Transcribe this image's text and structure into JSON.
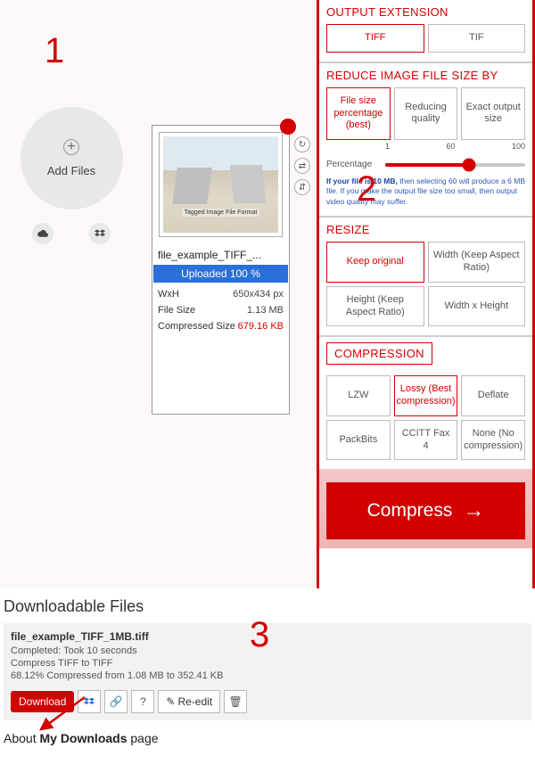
{
  "annotations": {
    "step1": "1",
    "step2": "2",
    "step3": "3"
  },
  "addFiles": {
    "label": "Add Files"
  },
  "fileCard": {
    "thumbCaption": "Tagged Image File Format",
    "name": "file_example_TIFF_...",
    "uploadStatus": "Uploaded 100 %",
    "meta": {
      "wxh_label": "WxH",
      "wxh_value": "650x434 px",
      "size_label": "File Size",
      "size_value": "1.13 MB",
      "comp_label": "Compressed Size",
      "comp_value": "679.16 KB"
    }
  },
  "panel": {
    "outputExt": {
      "title": "OUTPUT EXTENSION",
      "options": [
        "TIFF",
        "TIF"
      ],
      "selected": "TIFF"
    },
    "reduce": {
      "title": "REDUCE IMAGE FILE SIZE BY",
      "options": [
        "File size percentage (best)",
        "Reducing quality",
        "Exact output size"
      ],
      "selected": "File size percentage (best)",
      "sliderLabel": "Percentage",
      "sliderMin": "1",
      "sliderMid": "60",
      "sliderMax": "100",
      "sliderValue": 60,
      "hint_pre": "If your file is 10 MB,",
      "hint_rest": " then selecting 60 will produce a 6 MB file. If you make the output file size too small, then output video quality may suffer."
    },
    "resize": {
      "title": "RESIZE",
      "options": [
        "Keep original",
        "Width (Keep Aspect Ratio)",
        "Height (Keep Aspect Ratio)",
        "Width x Height"
      ],
      "selected": "Keep original"
    },
    "compression": {
      "title": "COMPRESSION",
      "options": [
        "LZW",
        "Lossy (Best compression)",
        "Deflate",
        "PackBits",
        "CCITT Fax 4",
        "None (No compression)"
      ],
      "selected": "Lossy (Best compression)"
    },
    "compressBtn": "Compress"
  },
  "downloads": {
    "heading": "Downloadable Files",
    "file": {
      "name": "file_example_TIFF_1MB.tiff",
      "completed": "Completed: Took 10 seconds",
      "op": "Compress TIFF to TIFF",
      "ratio": "68.12% Compressed from 1.08 MB to 352.41 KB"
    },
    "actions": {
      "download": "Download",
      "reedit": "Re-edit"
    }
  },
  "about": {
    "pre": "About ",
    "bold": "My Downloads",
    "post": " page"
  }
}
